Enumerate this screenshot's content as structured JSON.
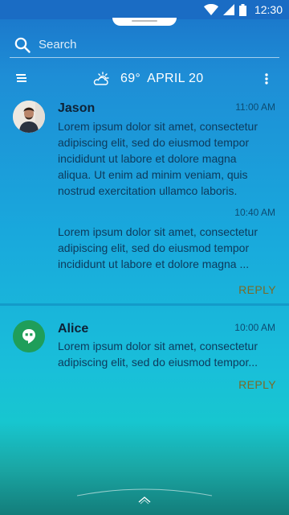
{
  "status_bar": {
    "time": "12:30",
    "icons": [
      "wifi-icon",
      "signal-icon",
      "battery-icon"
    ]
  },
  "search": {
    "placeholder": "Search"
  },
  "toolbar": {
    "weather_icon": "partly-cloudy-icon",
    "temperature": "69°",
    "date": "APRIL 20"
  },
  "conversations": [
    {
      "name": "Jason",
      "avatar": "profile-photo",
      "messages": [
        {
          "time": "11:00 AM",
          "lines": [
            "Lorem ipsum dolor sit amet, consectetur",
            "adipiscing elit, sed do eiusmod tempor",
            "incididunt ut labore et dolore magna",
            "aliqua. Ut enim ad minim veniam, quis",
            "nostrud exercitation ullamco laboris."
          ]
        },
        {
          "time": "10:40 AM",
          "lines": [
            "Lorem ipsum dolor sit amet, consectetur",
            "adipiscing elit, sed do eiusmod tempor",
            "incididunt ut labore et dolore magna ..."
          ]
        }
      ],
      "reply_label": "REPLY"
    },
    {
      "name": "Alice",
      "avatar": "hangouts-icon",
      "messages": [
        {
          "time": "10:00 AM",
          "lines": [
            "Lorem ipsum dolor sit amet, consectetur",
            "adipiscing elit, sed do eiusmod tempor..."
          ]
        }
      ],
      "reply_label": "REPLY"
    }
  ],
  "colors": {
    "status_bar": "#1a6cc4",
    "reply": "#7a6a27",
    "name": "#0e2236",
    "message": "#0d3a5c",
    "hangouts_green": "#1f9e5a"
  }
}
